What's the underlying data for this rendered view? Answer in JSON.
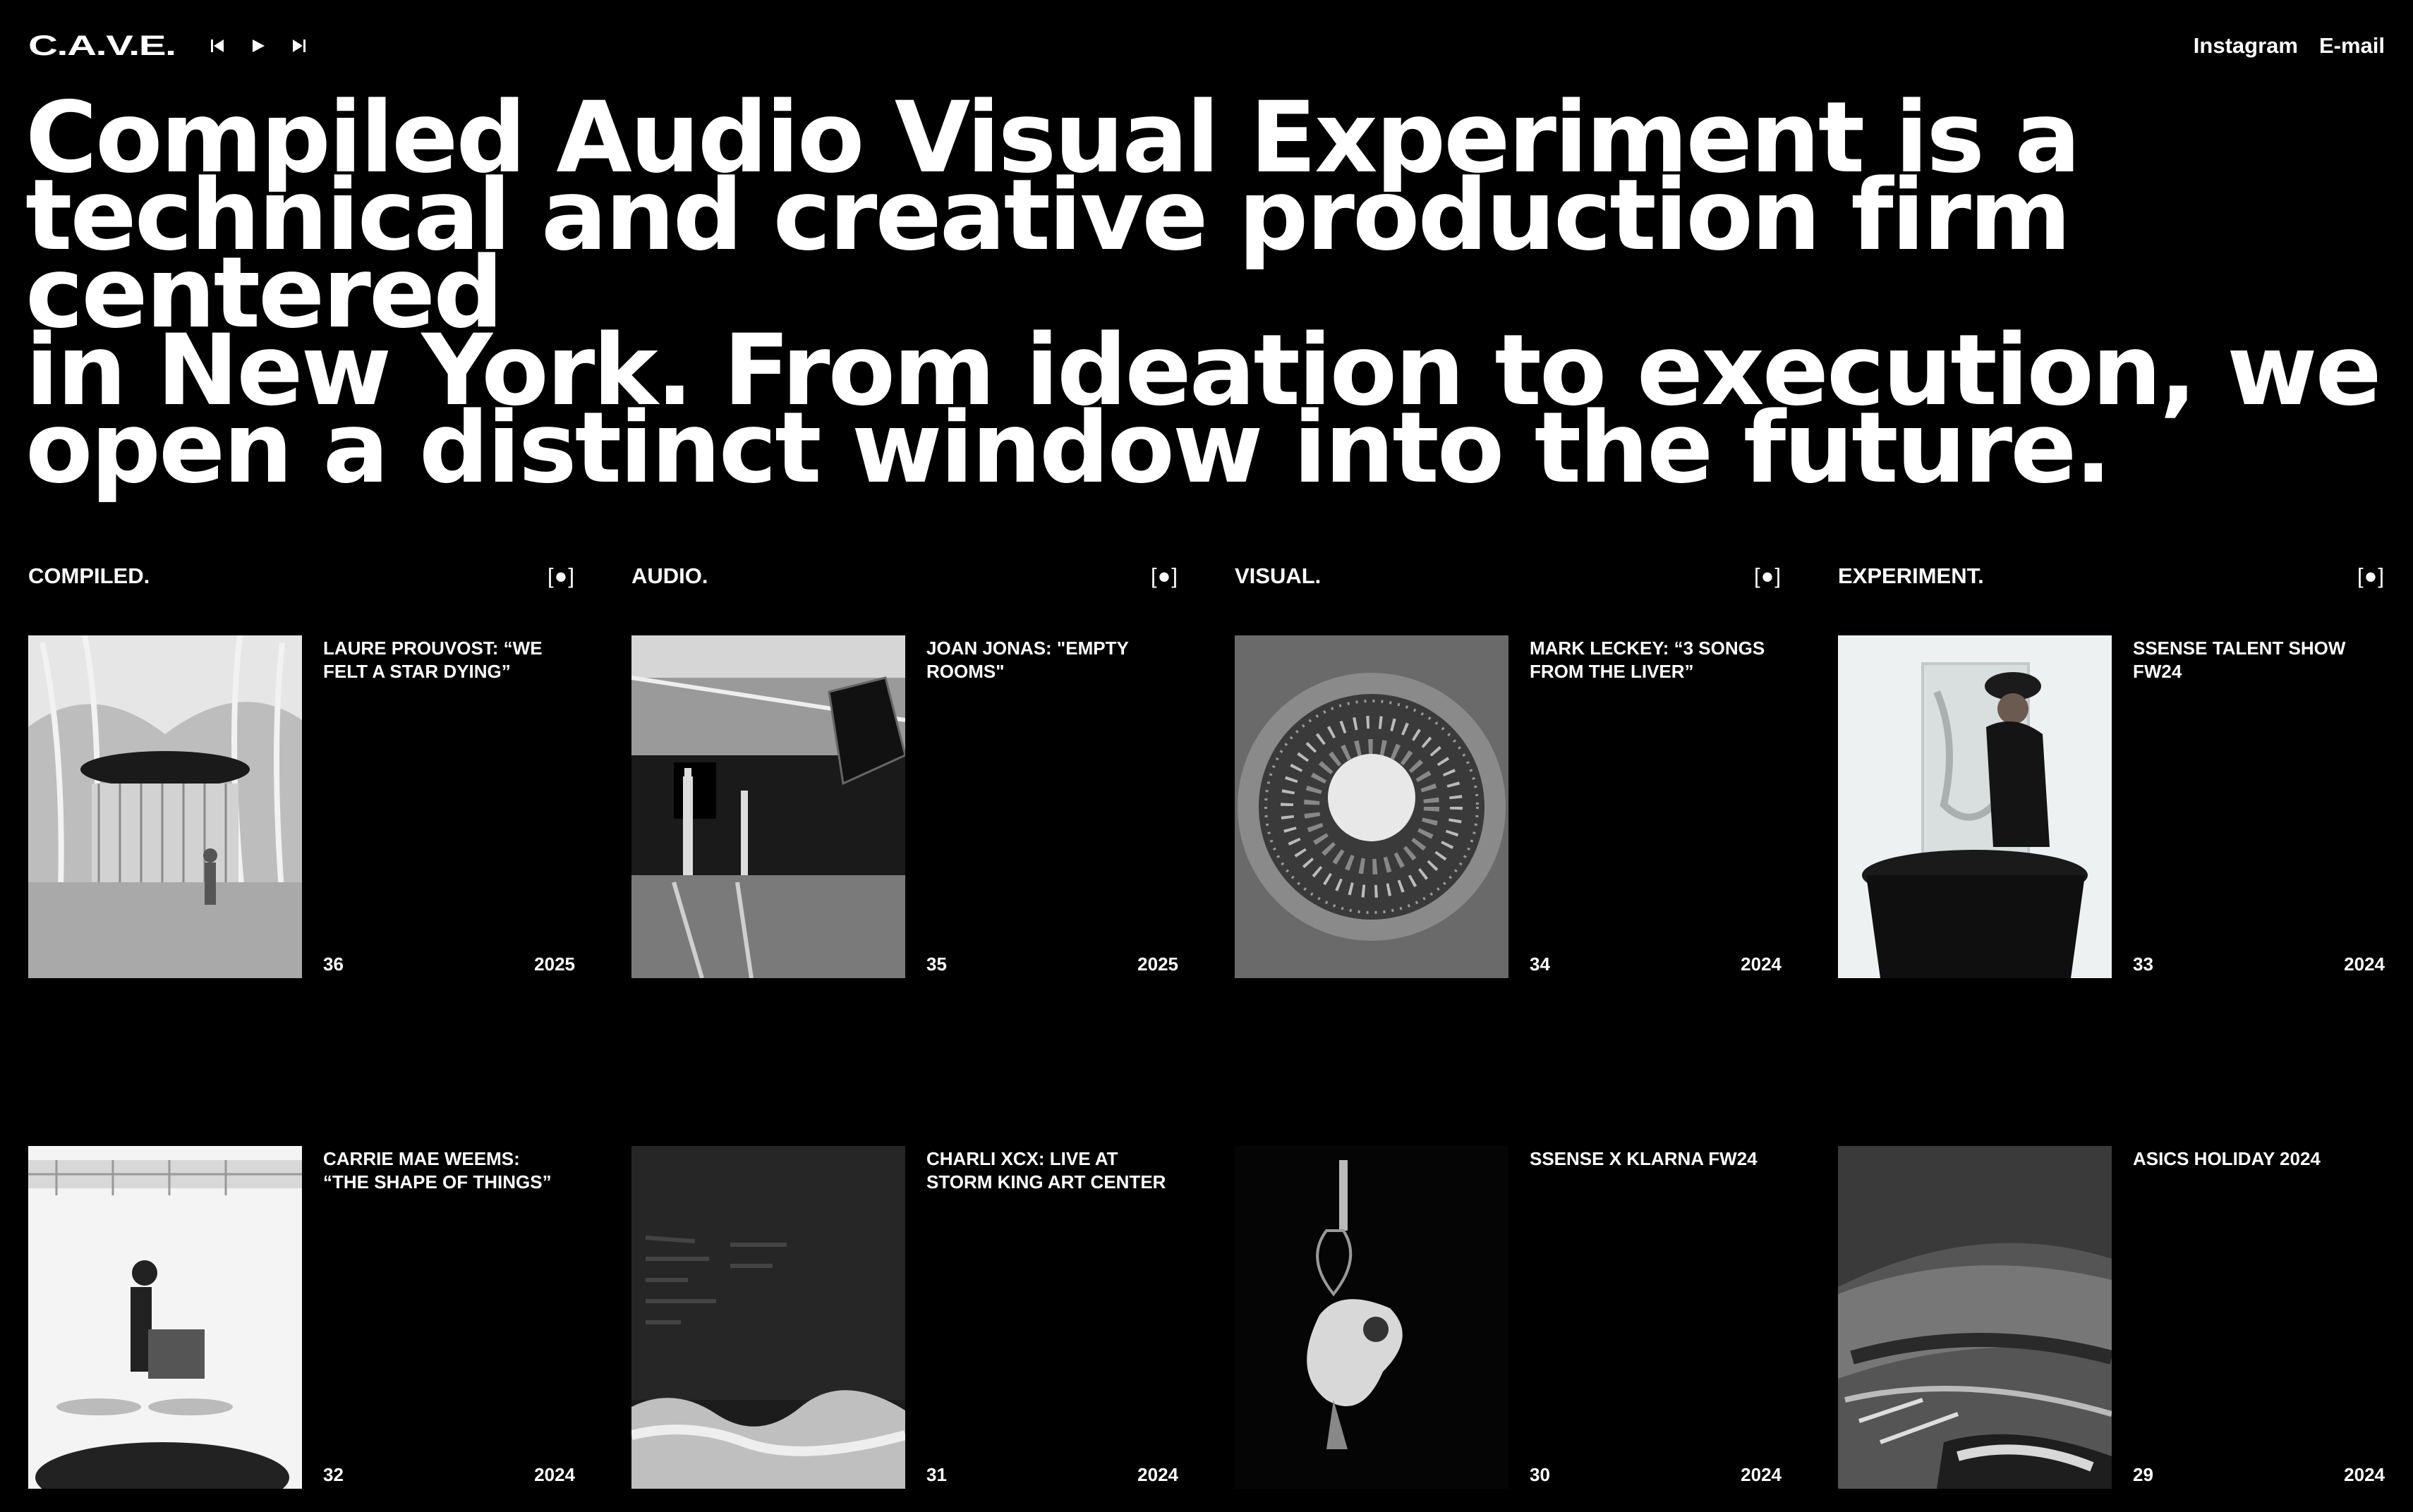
{
  "header": {
    "logo": "C.A.V.E.",
    "transport": [
      "previous-icon",
      "play-icon",
      "next-icon"
    ],
    "links": {
      "instagram": "Instagram",
      "email": "E-mail"
    }
  },
  "hero": {
    "lines": [
      "Compiled Audio Visual Experiment is a",
      "technical and creative production firm centered",
      "in New York. From ideation to execution, we",
      "open a distinct window into the future."
    ]
  },
  "columns": [
    {
      "heading": "COMPILED.",
      "toggle": "[●]",
      "cards": [
        {
          "title": "LAURE PROUVOST: “WE FELT A STAR DYING”",
          "number": "36",
          "year": "2025"
        },
        {
          "title": "CARRIE MAE WEEMS: “THE SHAPE OF THINGS”",
          "number": "32",
          "year": "2024"
        }
      ]
    },
    {
      "heading": "AUDIO.",
      "toggle": "[●]",
      "cards": [
        {
          "title": "JOAN JONAS: \"EMPTY ROOMS\"",
          "number": "35",
          "year": "2025"
        },
        {
          "title": "CHARLI XCX: LIVE AT STORM KING ART CENTER",
          "number": "31",
          "year": "2024"
        }
      ]
    },
    {
      "heading": "VISUAL.",
      "toggle": "[●]",
      "cards": [
        {
          "title": "MARK LECKEY: “3 SONGS FROM THE LIVER”",
          "number": "34",
          "year": "2024"
        },
        {
          "title": "SSENSE X KLARNA FW24",
          "number": "30",
          "year": "2024"
        }
      ]
    },
    {
      "heading": "EXPERIMENT.",
      "toggle": "[●]",
      "cards": [
        {
          "title": "SSENSE TALENT SHOW FW24",
          "number": "33",
          "year": "2024"
        },
        {
          "title": "ASICS HOLIDAY 2024",
          "number": "29",
          "year": "2024"
        }
      ]
    }
  ]
}
